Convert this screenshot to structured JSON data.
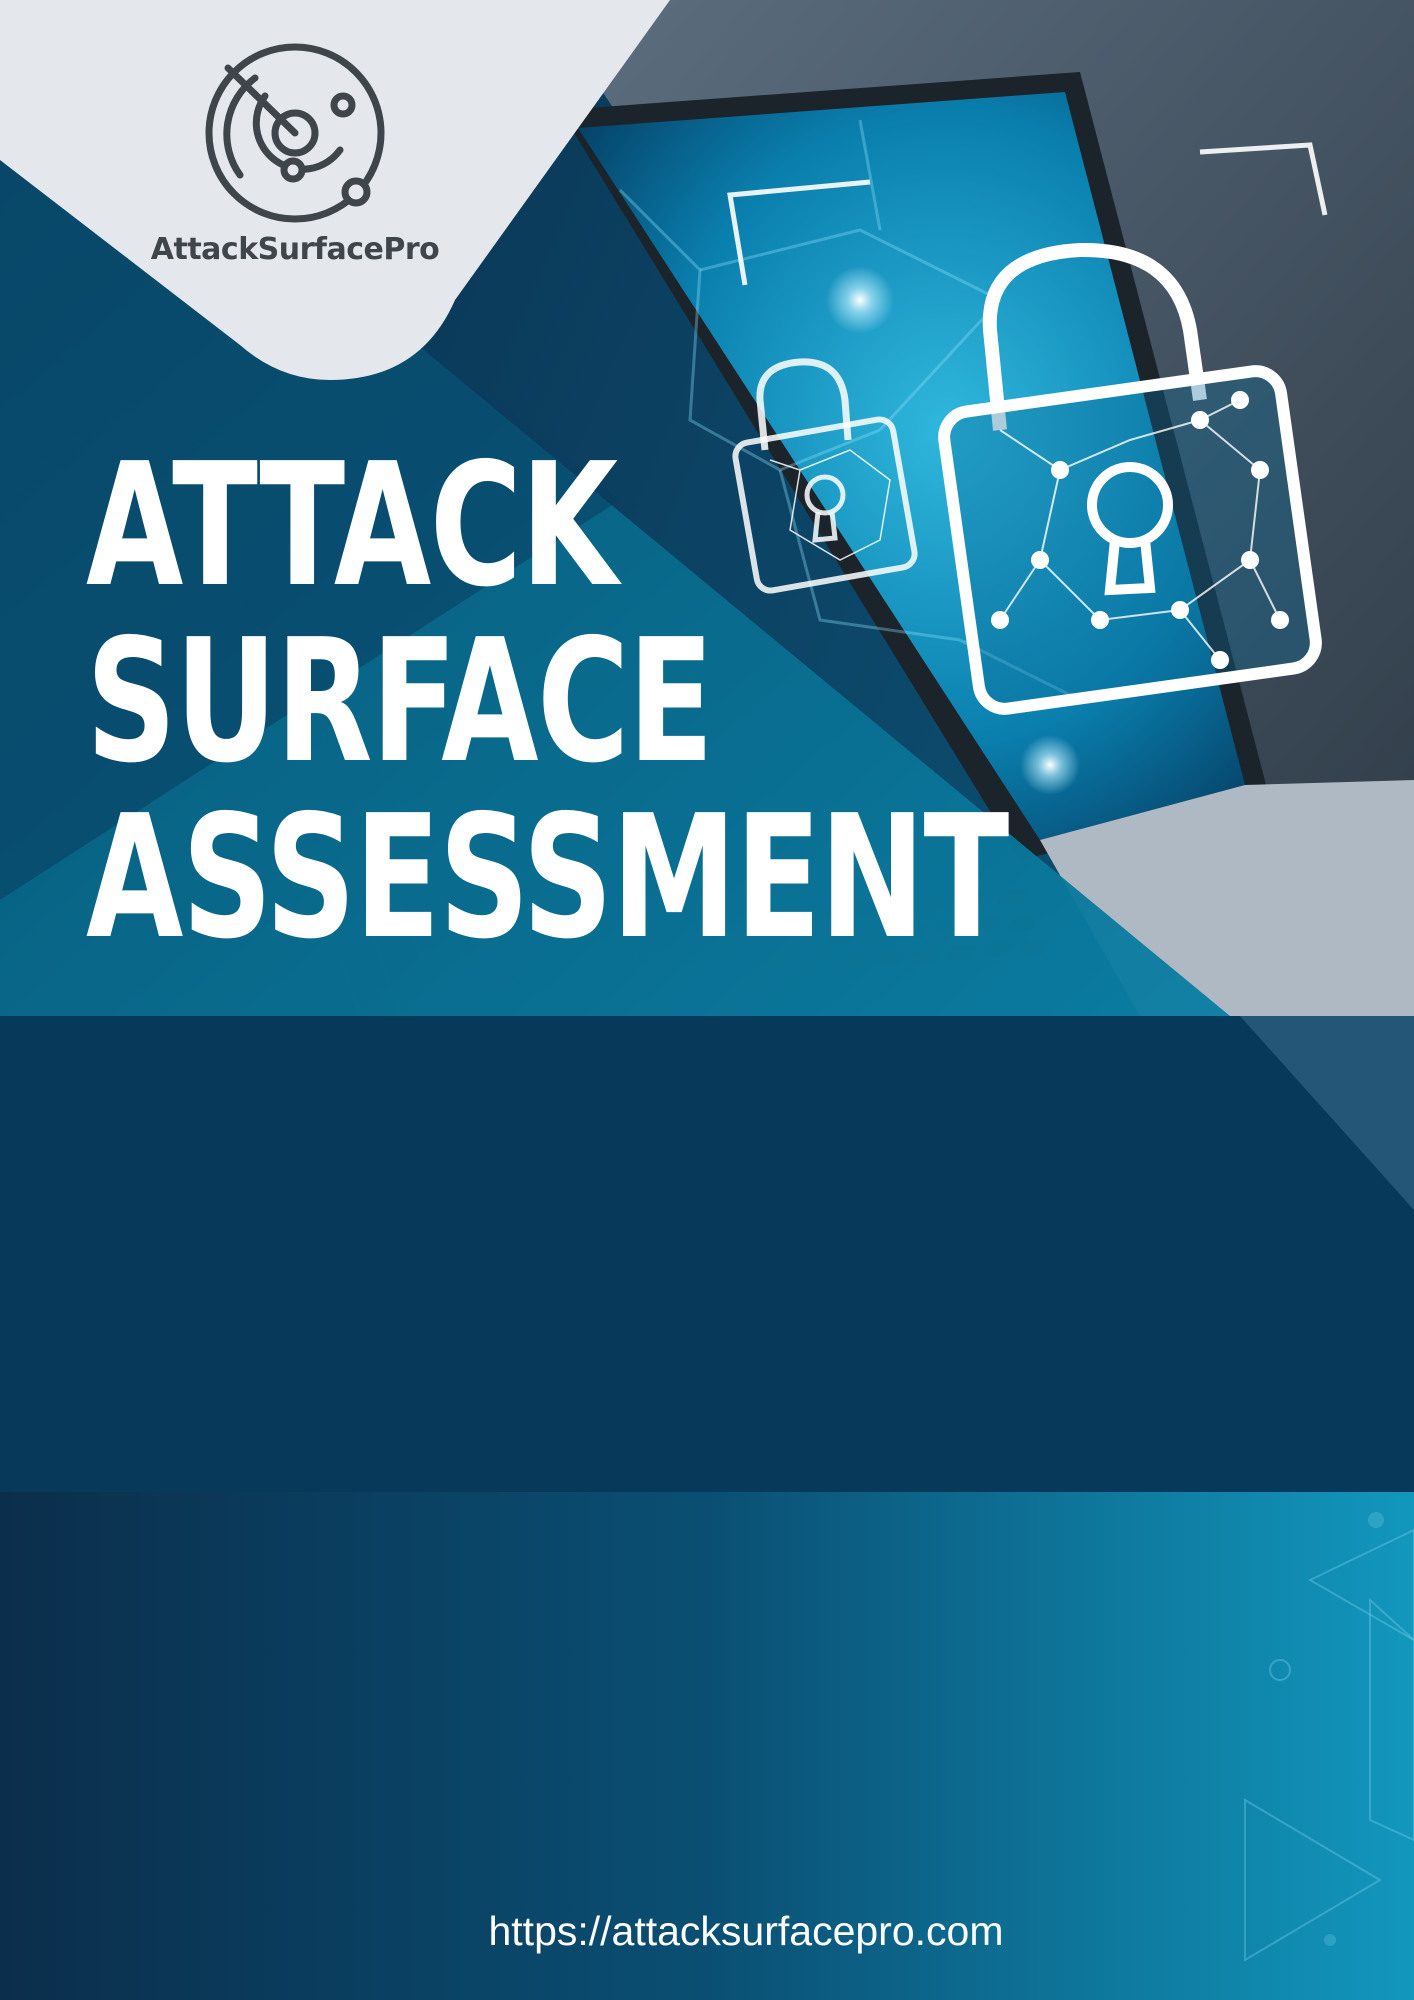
{
  "brand": {
    "name": "AttackSurfacePro",
    "logo_icon": "radar-icon"
  },
  "cover": {
    "title_lines": [
      "ATTACK",
      "SURFACE",
      "ASSESSMENT"
    ],
    "hero_image": "laptop-with-padlock-icon"
  },
  "footer": {
    "url": "https://attacksurfacepro.com"
  },
  "colors": {
    "navy": "#0b3a57",
    "teal": "#0a7ea3",
    "logo_panel": "#e4e8ec",
    "logo_ink": "#3e454b",
    "text": "#ffffff"
  }
}
